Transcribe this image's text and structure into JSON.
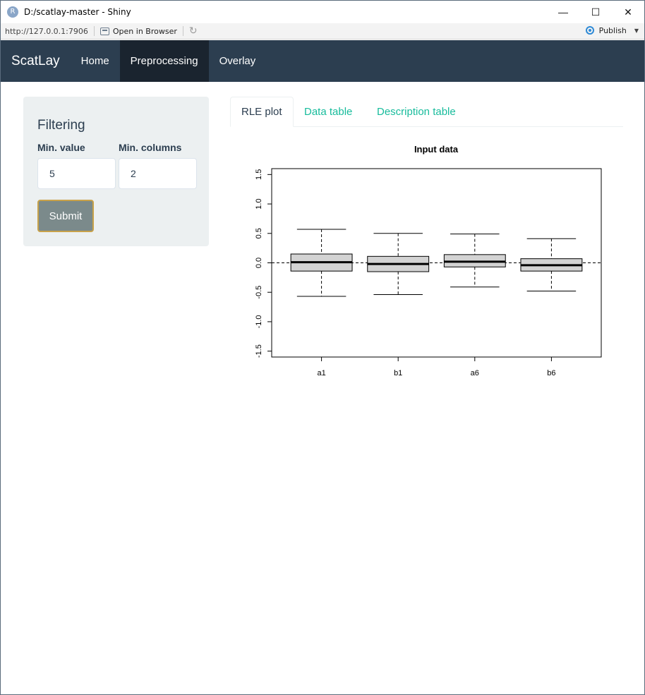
{
  "window": {
    "app_icon": "R",
    "title": "D:/scatlay-master - Shiny",
    "controls": {
      "minimize": "—",
      "maximize": "☐",
      "close": "✕"
    }
  },
  "toolbar": {
    "url": "http://127.0.0.1:7906",
    "open_in_browser": "Open in Browser",
    "refresh_icon": "↻",
    "publish": "Publish",
    "publish_caret": "▼"
  },
  "navbar": {
    "brand": "ScatLay",
    "items": [
      {
        "label": "Home"
      },
      {
        "label": "Preprocessing",
        "active": true
      },
      {
        "label": "Overlay"
      }
    ]
  },
  "sidebar": {
    "title": "Filtering",
    "min_value": {
      "label": "Min. value",
      "value": "5"
    },
    "min_columns": {
      "label": "Min. columns",
      "value": "2"
    },
    "submit_label": "Submit"
  },
  "tabs": [
    {
      "label": "RLE plot",
      "active": true
    },
    {
      "label": "Data table"
    },
    {
      "label": "Description table"
    }
  ],
  "colors": {
    "navbar": "#2c3e50",
    "navbar_active": "#1a242f",
    "tab_link": "#18bc9c",
    "box_fill": "#d3d3d3",
    "submit_bg": "#7b8a8b"
  },
  "chart_data": {
    "type": "boxplot",
    "title": "Input data",
    "xlabel": "",
    "ylabel": "",
    "categories": [
      "a1",
      "b1",
      "a6",
      "b6"
    ],
    "ylim": [
      -1.6,
      1.6
    ],
    "yticks": [
      "-1.5",
      "-1.0",
      "-0.5",
      "0.0",
      "0.5",
      "1.0",
      "1.5"
    ],
    "ytick_values": [
      -1.5,
      -1.0,
      -0.5,
      0.0,
      0.5,
      1.0,
      1.5
    ],
    "reference_line": 0,
    "boxes": [
      {
        "name": "a1",
        "min": -0.57,
        "q1": -0.14,
        "median": 0.01,
        "q3": 0.15,
        "max": 0.57
      },
      {
        "name": "b1",
        "min": -0.54,
        "q1": -0.15,
        "median": -0.02,
        "q3": 0.11,
        "max": 0.5
      },
      {
        "name": "a6",
        "min": -0.41,
        "q1": -0.07,
        "median": 0.02,
        "q3": 0.14,
        "max": 0.49
      },
      {
        "name": "b6",
        "min": -0.48,
        "q1": -0.14,
        "median": -0.04,
        "q3": 0.07,
        "max": 0.41
      }
    ]
  }
}
